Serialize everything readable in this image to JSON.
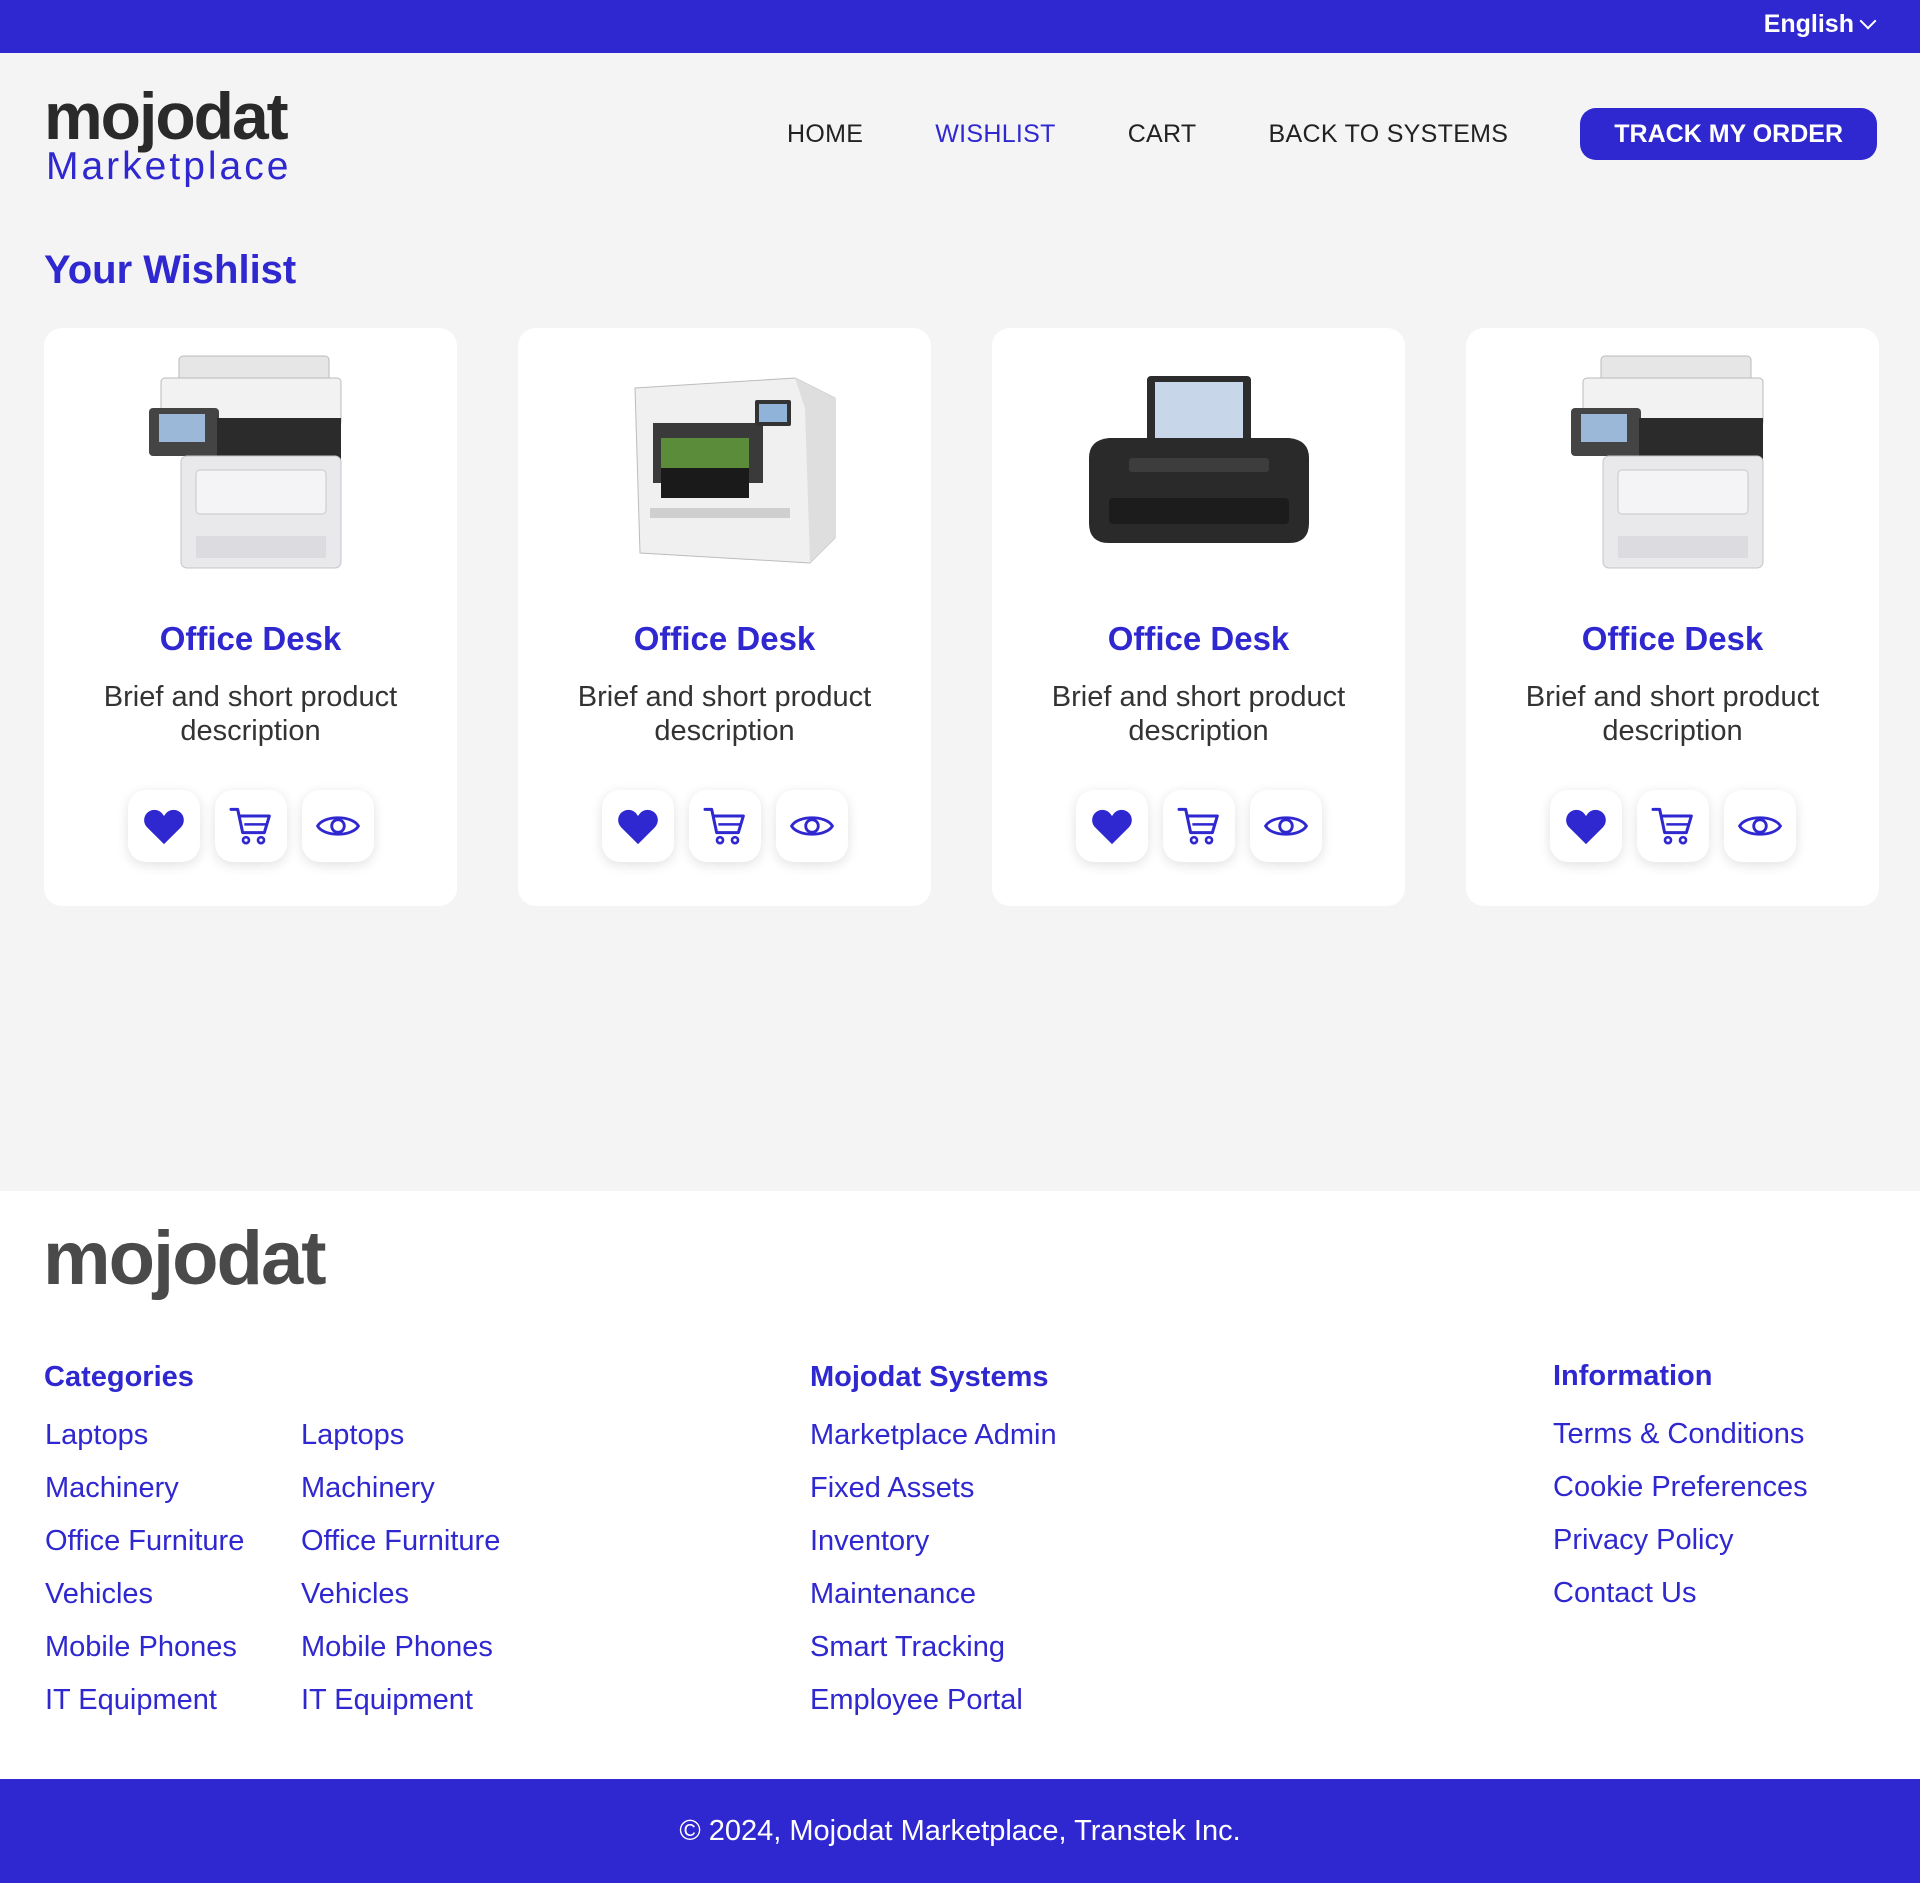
{
  "topbar": {
    "language": "English"
  },
  "header": {
    "logo_word": "mojodat",
    "logo_sub": "Marketplace",
    "nav": [
      {
        "label": "HOME"
      },
      {
        "label": "WISHLIST"
      },
      {
        "label": "CART"
      },
      {
        "label": "BACK TO SYSTEMS"
      }
    ],
    "track_button": "TRACK MY ORDER"
  },
  "page_title": "Your Wishlist",
  "cards": [
    {
      "name": "Office Desk",
      "desc": "Brief and short product description",
      "image": "multifunction-printer"
    },
    {
      "name": "Office Desk",
      "desc": "Brief and short product description",
      "image": "label-printer"
    },
    {
      "name": "Office Desk",
      "desc": "Brief and short product description",
      "image": "photo-printer"
    },
    {
      "name": "Office Desk",
      "desc": "Brief and short product description",
      "image": "multifunction-printer"
    }
  ],
  "footer": {
    "logo_word": "mojodat",
    "categories_title": "Categories",
    "categories_col1": [
      "Laptops",
      "Machinery",
      "Office Furniture",
      "Vehicles",
      "Mobile Phones",
      "IT Equipment"
    ],
    "categories_col2": [
      "Laptops",
      "Machinery",
      "Office Furniture",
      "Vehicles",
      "Mobile Phones",
      "IT Equipment"
    ],
    "systems_title": "Mojodat Systems",
    "systems": [
      "Marketplace Admin",
      "Fixed Assets",
      "Inventory",
      "Maintenance",
      "Smart Tracking",
      "Employee Portal"
    ],
    "info_title": "Information",
    "info": [
      "Terms & Conditions",
      "Cookie Preferences",
      "Privacy Policy",
      "Contact Us"
    ],
    "copyright": "© 2024, Mojodat Marketplace, Transtek Inc."
  },
  "colors": {
    "accent": "#2f27cf",
    "background": "#f4f4f4",
    "logo_dot": "#f28c28"
  }
}
